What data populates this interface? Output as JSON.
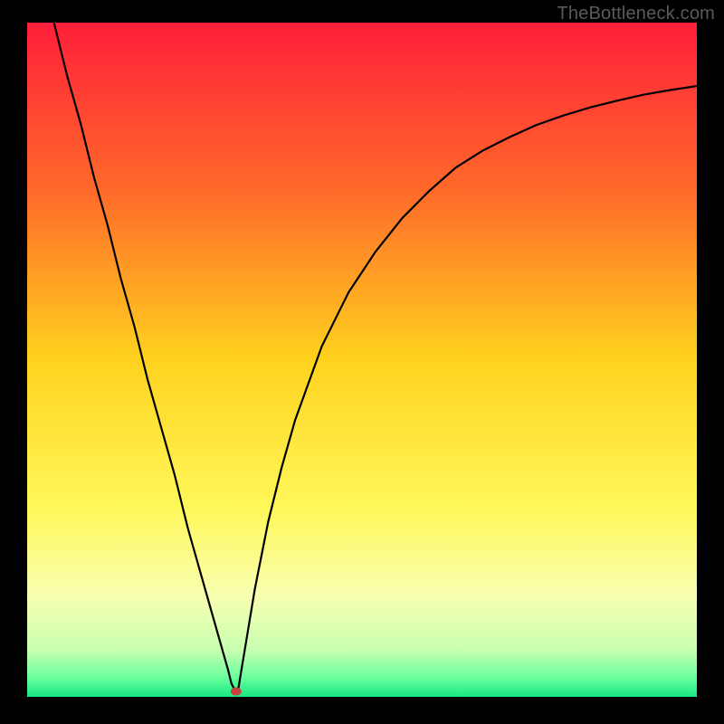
{
  "watermark": "TheBottleneck.com",
  "chart_data": {
    "type": "line",
    "title": "",
    "xlabel": "",
    "ylabel": "",
    "xlim": [
      0,
      100
    ],
    "ylim": [
      0,
      100
    ],
    "grid": false,
    "legend": false,
    "background_gradient_stops": [
      {
        "offset": 0.0,
        "color": "#ff1f3a"
      },
      {
        "offset": 0.25,
        "color": "#ff6a2a"
      },
      {
        "offset": 0.5,
        "color": "#ffd21e"
      },
      {
        "offset": 0.72,
        "color": "#fff85a"
      },
      {
        "offset": 0.85,
        "color": "#f8ffb0"
      },
      {
        "offset": 0.93,
        "color": "#c8ffb0"
      },
      {
        "offset": 0.97,
        "color": "#6eff9e"
      },
      {
        "offset": 1.0,
        "color": "#17e884"
      }
    ],
    "series": [
      {
        "name": "bottleneck-curve",
        "x": [
          4,
          6,
          8,
          10,
          12,
          14,
          16,
          18,
          20,
          22,
          24,
          26,
          28,
          30,
          30.5,
          31,
          31.5,
          32,
          33,
          34,
          36,
          38,
          40,
          44,
          48,
          52,
          56,
          60,
          64,
          68,
          72,
          76,
          80,
          84,
          88,
          92,
          96,
          100
        ],
        "y": [
          100,
          92,
          85,
          77,
          70,
          62,
          55,
          47,
          40,
          33,
          25,
          18,
          11,
          4,
          2,
          1,
          1,
          4,
          10,
          16,
          26,
          34,
          41,
          52,
          60,
          66,
          71,
          75,
          78.5,
          81,
          83,
          84.8,
          86.2,
          87.4,
          88.4,
          89.3,
          90,
          90.6
        ]
      }
    ],
    "marker": {
      "x": 31.2,
      "y": 0.8,
      "color": "#c8433f",
      "rx": 6,
      "ry": 4.5
    }
  }
}
